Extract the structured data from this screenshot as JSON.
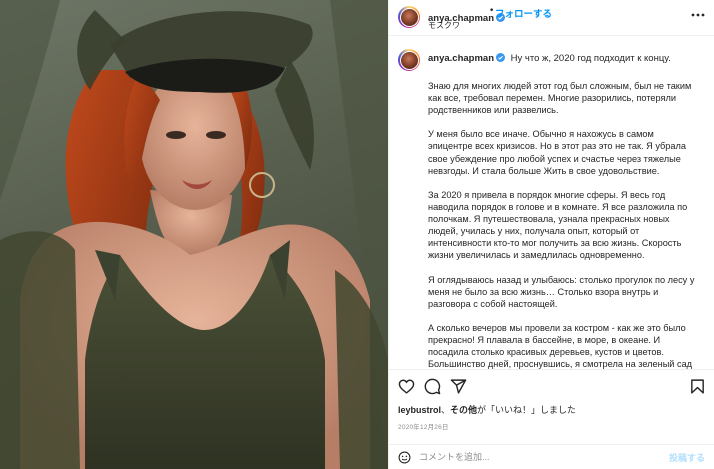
{
  "post": {
    "username": "anya.chapman",
    "follow_label": "フォローする",
    "separator": "•",
    "location": "モスクワ",
    "photo_alt": "Woman with red hair wearing a green military cap and green dress"
  },
  "caption": {
    "username": "anya.chapman",
    "first_line": "Ну что ж, 2020 год подходит к концу.",
    "paragraphs": [
      "Знаю для многих людей этот год был сложным, был не таким как все, требовал перемен. Многие разорились, потеряли родственников или развелись.",
      "У меня было все иначе. Обычно я нахожусь в самом эпицентре всех кризисов. Но в этот раз это не так. Я убрала свое убеждение про любой успех и счастье через тяжелые невзгоды. И стала больше Жить в свое удовольствие.",
      "За 2020 я привела в порядок многие сферы. Я весь год наводила порядок в голове и в комнате. Я все разложила по полочкам. Я путешествовала, узнала прекрасных новых людей, училась у них, получала опыт, который от интенсивности кто-то мог получить за всю жизнь. Скорость жизни увеличилась и замедлилась одновременно.",
      "Я оглядываюсь назад и улыбаюсь: столько прогулок по лесу у меня не было за всю жизнь… Столько взора внутрь и разговора с собой настоящей.",
      "А сколько вечеров мы провели за костром - как же это было прекрасно! Я плавала в бассейне, в море, в океане. И посадила столько красивых деревьев, кустов и цветов. Большинство дней, проснувшись, я смотрела на зеленый сад или сад, покрытый"
    ]
  },
  "likes": {
    "user": "leybustrol",
    "connector": "、",
    "others": "その他",
    "suffix": "が「いいね！」しました"
  },
  "date": "2020年12月26日",
  "comment": {
    "placeholder": "コメントを追加...",
    "post_label": "投稿する"
  },
  "colors": {
    "accent": "#0095f6",
    "verified": "#3897f0",
    "post_disabled": "#b2dffc",
    "secondary_text": "#8e8e8e"
  },
  "icons": [
    "verified-badge-icon",
    "more-options-icon",
    "heart-icon",
    "comment-icon",
    "share-icon",
    "bookmark-icon",
    "emoji-icon"
  ]
}
